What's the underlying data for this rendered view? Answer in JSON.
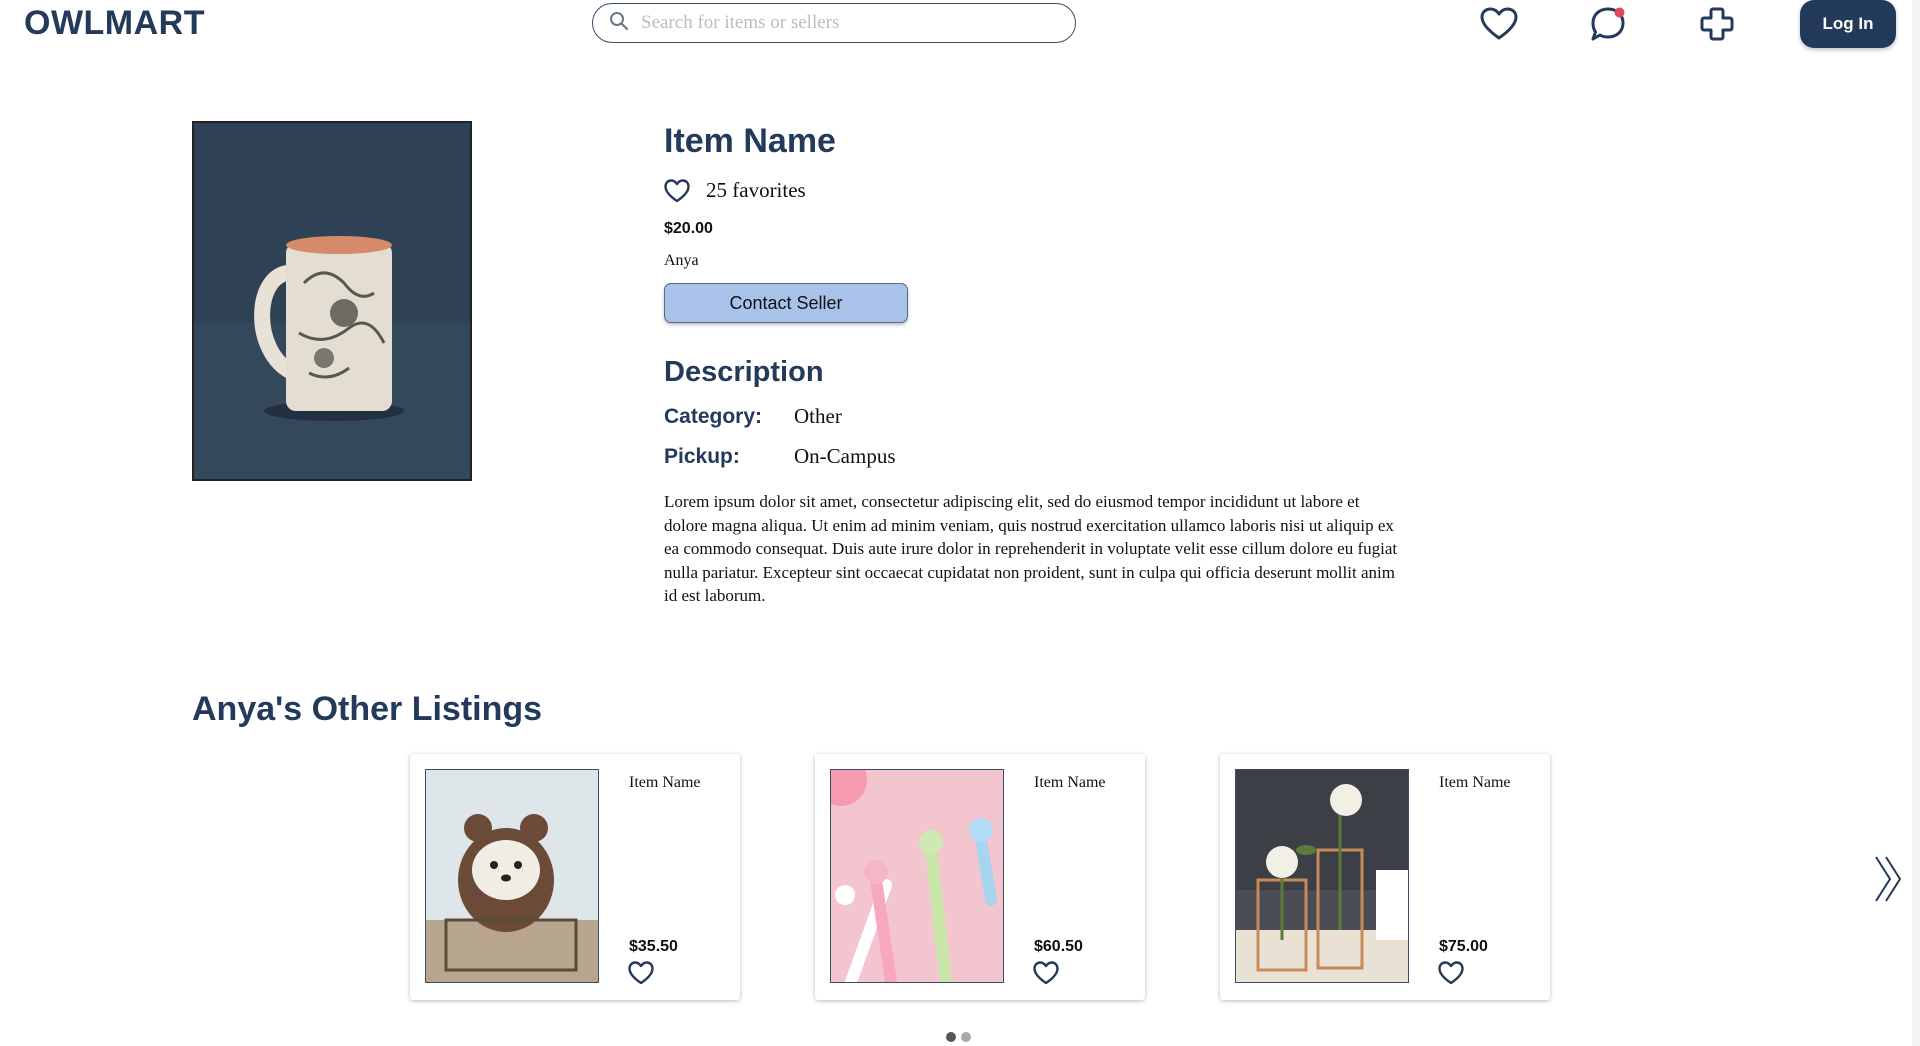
{
  "header": {
    "logo": "OWLMART",
    "search_placeholder": "Search for items or sellers",
    "login_label": "Log In"
  },
  "product": {
    "name": "Item Name",
    "favorites": "25 favorites",
    "price": "$20.00",
    "seller": "Anya",
    "contact_label": "Contact Seller",
    "description_heading": "Description",
    "category_label": "Category:",
    "category_value": "Other",
    "pickup_label": "Pickup:",
    "pickup_value": "On-Campus",
    "description": "Lorem ipsum dolor sit amet, consectetur adipiscing elit, sed do eiusmod tempor incididunt ut labore et dolore magna aliqua. Ut enim ad minim veniam, quis nostrud exercitation ullamco laboris nisi ut aliquip ex ea commodo consequat. Duis aute irure dolor in reprehenderit in voluptate velit esse cillum dolore eu fugiat nulla pariatur. Excepteur sint occaecat cupidatat non proident, sunt in culpa qui officia deserunt mollit anim id est laborum."
  },
  "other_listings": {
    "heading": "Anya's Other Listings",
    "items": [
      {
        "name": "Item Name",
        "price": "$35.50",
        "image": "teddy-bear"
      },
      {
        "name": "Item Name",
        "price": "$60.50",
        "image": "pink-pens"
      },
      {
        "name": "Item Name",
        "price": "$75.00",
        "image": "rose-vases"
      }
    ],
    "pages": 2,
    "active_page": 1
  },
  "colors": {
    "brand": "#233a5a",
    "contact_button": "#a9c2ea",
    "notification_dot": "#e0485a"
  }
}
